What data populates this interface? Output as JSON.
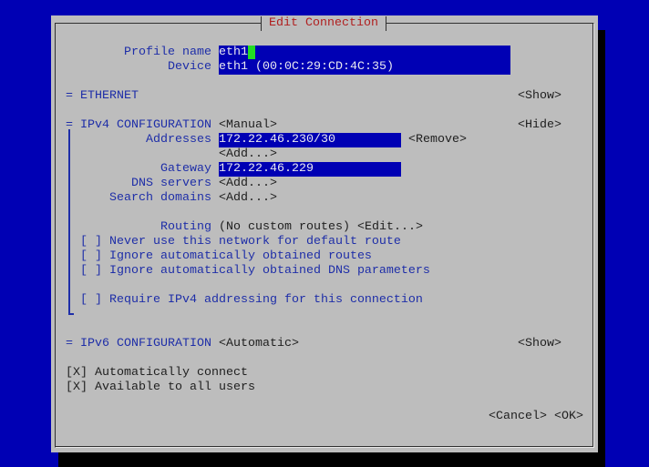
{
  "dialog": {
    "title": "Edit Connection"
  },
  "profile": {
    "label": "Profile name",
    "value": "eth1"
  },
  "device": {
    "label": "Device",
    "value": "eth1 (00:0C:29:CD:4C:35)"
  },
  "ethernet": {
    "label": "= ETHERNET",
    "toggle": "<Show>"
  },
  "ipv4": {
    "label": "IPv4 CONFIGURATION",
    "marker": "=",
    "mode": "<Manual>",
    "toggle": "<Hide>",
    "addresses_label": "Addresses",
    "address_value": "172.22.46.230/30",
    "remove": "<Remove>",
    "add_address": "<Add...>",
    "gateway_label": "Gateway",
    "gateway_value": "172.22.46.229",
    "dns_label": "DNS servers",
    "dns_add": "<Add...>",
    "search_label": "Search domains",
    "search_add": "<Add...>",
    "routing_label": "Routing",
    "routing_value": "(No custom routes)",
    "routing_edit": "<Edit...>",
    "checkboxes": [
      {
        "box": "[ ]",
        "label": "Never use this network for default route",
        "checked": false
      },
      {
        "box": "[ ]",
        "label": "Ignore automatically obtained routes",
        "checked": false
      },
      {
        "box": "[ ]",
        "label": "Ignore automatically obtained DNS parameters",
        "checked": false
      },
      {
        "box": "[ ]",
        "label": "Require IPv4 addressing for this connection",
        "checked": false
      }
    ]
  },
  "ipv6": {
    "label": "= IPv6 CONFIGURATION",
    "mode": "<Automatic>",
    "toggle": "<Show>"
  },
  "options": [
    {
      "box": "[X]",
      "label": "Automatically connect",
      "checked": true
    },
    {
      "box": "[X]",
      "label": "Available to all users",
      "checked": true
    }
  ],
  "buttons": {
    "cancel": "<Cancel>",
    "ok": "<OK>"
  },
  "colors": {
    "background": "#0000b4",
    "dialog": "#bdbdbd",
    "field": "#0000b4",
    "cursor": "#22dd22",
    "title": "#b02020"
  }
}
